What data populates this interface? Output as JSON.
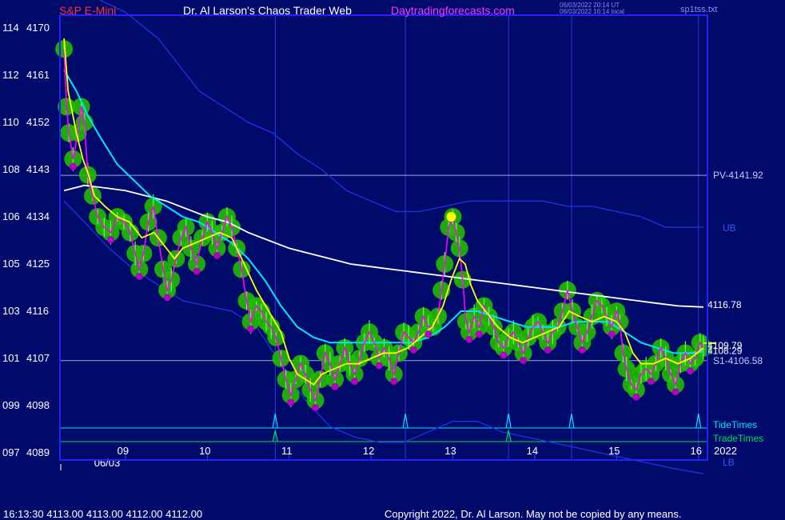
{
  "header": {
    "symbol": "S&P E-Mini",
    "site": "Dr. Al Larson's Chaos Trader Web",
    "url": "Daytradingforecasts.com",
    "time_utc": "06/03/2022 20:14 UT",
    "time_local": "06/03/2022 16:14 local",
    "file": "sp1tss.txt"
  },
  "footer": {
    "ohlc": "16:13:30  4113.00 4113.00 4112.00 4112.00",
    "copyright": "Copyright 2022, Dr. Al Larson. May not be copied by any means."
  },
  "colors": {
    "background": "#000a6b",
    "frame": "#2222ff",
    "price": "#ff00ff",
    "price_halo": "#22bb00",
    "fast_ma": "#ffff00",
    "slow_ma": "#00e5ff",
    "long_ma": "#ffffff",
    "bands": "#1f33e6",
    "tide": "#00e5ff",
    "trade": "#00dd55"
  },
  "chart_data": {
    "type": "line",
    "title": "S&P E-Mini",
    "date_label": "06/03",
    "year_label": "2022",
    "x_tick_labels": [
      "09",
      "10",
      "11",
      "12",
      "13",
      "14",
      "15",
      "16"
    ],
    "x_range": [
      8.25,
      16.1
    ],
    "y_range": [
      4089,
      4170
    ],
    "y_ticks": [
      {
        "left": "097",
        "right": "4089",
        "value": 4089
      },
      {
        "left": "099",
        "right": "4098",
        "value": 4098
      },
      {
        "left": "101",
        "right": "4107",
        "value": 4107
      },
      {
        "left": "103",
        "right": "4116",
        "value": 4116
      },
      {
        "left": "105",
        "right": "4125",
        "value": 4125
      },
      {
        "left": "106",
        "right": "4134",
        "value": 4134
      },
      {
        "left": "108",
        "right": "4143",
        "value": 4143
      },
      {
        "left": "110",
        "right": "4152",
        "value": 4152
      },
      {
        "left": "112",
        "right": "4161",
        "value": 4161
      },
      {
        "left": "114",
        "right": "4170",
        "value": 4170
      }
    ],
    "levels": [
      {
        "label": "PV-4141.92",
        "value": 4141.92
      },
      {
        "label": "S1-4106.58",
        "value": 4106.58
      }
    ],
    "end_labels": {
      "long_ma": "4116.78",
      "slow_ma": "4108.29",
      "fast_ma": "4109.79",
      "upper_band": "UB",
      "lower_band": "LB"
    },
    "tide_times_label": "TideTimes",
    "trade_times_label": "TradeTimes",
    "tide_times": [
      10.83,
      12.42,
      13.68,
      14.45,
      16.0
    ],
    "trade_times": [
      10.83,
      13.68
    ],
    "price": [
      [
        8.25,
        4166
      ],
      [
        8.28,
        4155
      ],
      [
        8.31,
        4150
      ],
      [
        8.36,
        4145
      ],
      [
        8.42,
        4150
      ],
      [
        8.46,
        4155
      ],
      [
        8.5,
        4152
      ],
      [
        8.54,
        4142
      ],
      [
        8.6,
        4138
      ],
      [
        8.66,
        4134
      ],
      [
        8.74,
        4132
      ],
      [
        8.82,
        4131
      ],
      [
        8.9,
        4134
      ],
      [
        8.98,
        4133
      ],
      [
        9.06,
        4131
      ],
      [
        9.12,
        4127
      ],
      [
        9.17,
        4124
      ],
      [
        9.22,
        4127
      ],
      [
        9.28,
        4133
      ],
      [
        9.34,
        4136
      ],
      [
        9.4,
        4130
      ],
      [
        9.46,
        4124
      ],
      [
        9.51,
        4120
      ],
      [
        9.56,
        4122
      ],
      [
        9.62,
        4126
      ],
      [
        9.68,
        4130
      ],
      [
        9.74,
        4132
      ],
      [
        9.8,
        4128
      ],
      [
        9.87,
        4125
      ],
      [
        9.94,
        4130
      ],
      [
        10.0,
        4133
      ],
      [
        10.06,
        4131
      ],
      [
        10.12,
        4128
      ],
      [
        10.18,
        4131
      ],
      [
        10.24,
        4134
      ],
      [
        10.3,
        4132
      ],
      [
        10.36,
        4128
      ],
      [
        10.42,
        4124
      ],
      [
        10.48,
        4118
      ],
      [
        10.53,
        4114
      ],
      [
        10.6,
        4117
      ],
      [
        10.66,
        4116
      ],
      [
        10.72,
        4114
      ],
      [
        10.78,
        4113
      ],
      [
        10.84,
        4111
      ],
      [
        10.9,
        4107
      ],
      [
        10.96,
        4103
      ],
      [
        11.02,
        4100
      ],
      [
        11.08,
        4103
      ],
      [
        11.14,
        4106
      ],
      [
        11.2,
        4104
      ],
      [
        11.26,
        4101
      ],
      [
        11.32,
        4099
      ],
      [
        11.38,
        4103
      ],
      [
        11.44,
        4108
      ],
      [
        11.5,
        4106
      ],
      [
        11.56,
        4103
      ],
      [
        11.62,
        4106
      ],
      [
        11.68,
        4109
      ],
      [
        11.74,
        4106
      ],
      [
        11.8,
        4104
      ],
      [
        11.86,
        4107
      ],
      [
        11.92,
        4110
      ],
      [
        11.98,
        4112
      ],
      [
        12.04,
        4110
      ],
      [
        12.1,
        4107
      ],
      [
        12.16,
        4109
      ],
      [
        12.22,
        4107
      ],
      [
        12.28,
        4104
      ],
      [
        12.34,
        4108
      ],
      [
        12.4,
        4112
      ],
      [
        12.46,
        4111
      ],
      [
        12.52,
        4110
      ],
      [
        12.58,
        4112
      ],
      [
        12.64,
        4115
      ],
      [
        12.7,
        4113
      ],
      [
        12.76,
        4113
      ],
      [
        12.82,
        4115
      ],
      [
        12.86,
        4120
      ],
      [
        12.9,
        4125
      ],
      [
        12.95,
        4132
      ],
      [
        13.0,
        4134
      ],
      [
        13.04,
        4131
      ],
      [
        13.08,
        4128
      ],
      [
        13.12,
        4122
      ],
      [
        13.16,
        4114
      ],
      [
        13.2,
        4112
      ],
      [
        13.26,
        4115
      ],
      [
        13.32,
        4113
      ],
      [
        13.38,
        4117
      ],
      [
        13.44,
        4115
      ],
      [
        13.5,
        4113
      ],
      [
        13.56,
        4110
      ],
      [
        13.62,
        4109
      ],
      [
        13.68,
        4111
      ],
      [
        13.74,
        4112
      ],
      [
        13.8,
        4110
      ],
      [
        13.86,
        4108
      ],
      [
        13.92,
        4111
      ],
      [
        13.98,
        4113
      ],
      [
        14.04,
        4114
      ],
      [
        14.1,
        4112
      ],
      [
        14.16,
        4110
      ],
      [
        14.22,
        4112
      ],
      [
        14.28,
        4113
      ],
      [
        14.34,
        4116
      ],
      [
        14.4,
        4120
      ],
      [
        14.46,
        4116
      ],
      [
        14.52,
        4113
      ],
      [
        14.58,
        4110
      ],
      [
        14.64,
        4112
      ],
      [
        14.7,
        4115
      ],
      [
        14.76,
        4118
      ],
      [
        14.82,
        4117
      ],
      [
        14.88,
        4115
      ],
      [
        14.94,
        4113
      ],
      [
        15.0,
        4116
      ],
      [
        15.04,
        4114
      ],
      [
        15.08,
        4108
      ],
      [
        15.12,
        4105
      ],
      [
        15.18,
        4102
      ],
      [
        15.24,
        4101
      ],
      [
        15.3,
        4104
      ],
      [
        15.36,
        4105
      ],
      [
        15.42,
        4104
      ],
      [
        15.48,
        4106
      ],
      [
        15.54,
        4109
      ],
      [
        15.6,
        4107
      ],
      [
        15.66,
        4104
      ],
      [
        15.72,
        4102
      ],
      [
        15.78,
        4106
      ],
      [
        15.84,
        4108
      ],
      [
        15.9,
        4106
      ],
      [
        15.96,
        4107
      ],
      [
        16.02,
        4110
      ],
      [
        16.06,
        4109
      ]
    ],
    "fast_ma": [
      [
        8.25,
        4168
      ],
      [
        8.3,
        4158
      ],
      [
        8.4,
        4150
      ],
      [
        8.48,
        4145
      ],
      [
        8.55,
        4142
      ],
      [
        8.62,
        4138
      ],
      [
        8.75,
        4136
      ],
      [
        8.9,
        4134
      ],
      [
        9.05,
        4133
      ],
      [
        9.2,
        4130
      ],
      [
        9.35,
        4131
      ],
      [
        9.5,
        4128
      ],
      [
        9.6,
        4126
      ],
      [
        9.7,
        4128
      ],
      [
        9.85,
        4129
      ],
      [
        10.0,
        4130
      ],
      [
        10.15,
        4131
      ],
      [
        10.3,
        4130
      ],
      [
        10.45,
        4125
      ],
      [
        10.6,
        4120
      ],
      [
        10.75,
        4116
      ],
      [
        10.9,
        4112
      ],
      [
        11.0,
        4107
      ],
      [
        11.1,
        4104
      ],
      [
        11.2,
        4103
      ],
      [
        11.3,
        4102
      ],
      [
        11.4,
        4104
      ],
      [
        11.55,
        4105
      ],
      [
        11.7,
        4106
      ],
      [
        11.85,
        4106
      ],
      [
        12.0,
        4107
      ],
      [
        12.15,
        4108
      ],
      [
        12.3,
        4108
      ],
      [
        12.45,
        4109
      ],
      [
        12.6,
        4111
      ],
      [
        12.75,
        4113
      ],
      [
        12.88,
        4117
      ],
      [
        12.98,
        4122
      ],
      [
        13.08,
        4126
      ],
      [
        13.15,
        4125
      ],
      [
        13.22,
        4121
      ],
      [
        13.3,
        4118
      ],
      [
        13.4,
        4116
      ],
      [
        13.55,
        4113
      ],
      [
        13.7,
        4111
      ],
      [
        13.85,
        4110
      ],
      [
        14.0,
        4111
      ],
      [
        14.15,
        4112
      ],
      [
        14.3,
        4113
      ],
      [
        14.42,
        4116
      ],
      [
        14.55,
        4115
      ],
      [
        14.7,
        4114
      ],
      [
        14.85,
        4115
      ],
      [
        15.0,
        4114
      ],
      [
        15.1,
        4112
      ],
      [
        15.2,
        4108
      ],
      [
        15.3,
        4106
      ],
      [
        15.45,
        4106
      ],
      [
        15.6,
        4107
      ],
      [
        15.75,
        4106
      ],
      [
        15.9,
        4107
      ],
      [
        16.06,
        4109
      ]
    ],
    "slow_ma": [
      [
        8.25,
        4162
      ],
      [
        8.4,
        4158
      ],
      [
        8.55,
        4153
      ],
      [
        8.7,
        4149
      ],
      [
        8.9,
        4144
      ],
      [
        9.1,
        4141
      ],
      [
        9.3,
        4138
      ],
      [
        9.5,
        4136
      ],
      [
        9.7,
        4134
      ],
      [
        9.9,
        4133
      ],
      [
        10.1,
        4131
      ],
      [
        10.3,
        4129
      ],
      [
        10.5,
        4126
      ],
      [
        10.7,
        4122
      ],
      [
        10.9,
        4117
      ],
      [
        11.1,
        4113
      ],
      [
        11.3,
        4111
      ],
      [
        11.5,
        4110
      ],
      [
        11.7,
        4110
      ],
      [
        11.9,
        4110
      ],
      [
        12.1,
        4110
      ],
      [
        12.3,
        4110
      ],
      [
        12.5,
        4110
      ],
      [
        12.7,
        4111
      ],
      [
        12.9,
        4113
      ],
      [
        13.1,
        4116
      ],
      [
        13.3,
        4116
      ],
      [
        13.5,
        4115
      ],
      [
        13.7,
        4114
      ],
      [
        13.9,
        4113
      ],
      [
        14.1,
        4113
      ],
      [
        14.3,
        4113
      ],
      [
        14.5,
        4114
      ],
      [
        14.7,
        4114
      ],
      [
        14.9,
        4114
      ],
      [
        15.1,
        4112
      ],
      [
        15.3,
        4110
      ],
      [
        15.5,
        4109
      ],
      [
        15.7,
        4108
      ],
      [
        15.9,
        4108
      ],
      [
        16.06,
        4108.3
      ]
    ],
    "long_ma": [
      [
        8.25,
        4139
      ],
      [
        8.5,
        4140
      ],
      [
        8.75,
        4139.5
      ],
      [
        9.0,
        4139
      ],
      [
        9.25,
        4138
      ],
      [
        9.5,
        4137
      ],
      [
        9.75,
        4135.5
      ],
      [
        10.0,
        4134
      ],
      [
        10.25,
        4133
      ],
      [
        10.5,
        4131
      ],
      [
        10.75,
        4129.5
      ],
      [
        11.0,
        4128
      ],
      [
        11.25,
        4127
      ],
      [
        11.5,
        4126
      ],
      [
        11.75,
        4125
      ],
      [
        12.0,
        4124.5
      ],
      [
        12.25,
        4124
      ],
      [
        12.5,
        4123.5
      ],
      [
        12.75,
        4123
      ],
      [
        13.0,
        4122.5
      ],
      [
        13.25,
        4122
      ],
      [
        13.5,
        4121.5
      ],
      [
        13.75,
        4121
      ],
      [
        14.0,
        4120.5
      ],
      [
        14.25,
        4120
      ],
      [
        14.5,
        4119.5
      ],
      [
        14.75,
        4119
      ],
      [
        15.0,
        4118.5
      ],
      [
        15.25,
        4118
      ],
      [
        15.5,
        4117.5
      ],
      [
        15.75,
        4117
      ],
      [
        16.06,
        4116.8
      ]
    ],
    "upper_band": [
      [
        8.25,
        4178
      ],
      [
        8.6,
        4176
      ],
      [
        9.0,
        4173
      ],
      [
        9.4,
        4168
      ],
      [
        9.7,
        4162
      ],
      [
        9.9,
        4158
      ],
      [
        10.2,
        4155
      ],
      [
        10.5,
        4152
      ],
      [
        10.8,
        4150
      ],
      [
        11.1,
        4146
      ],
      [
        11.4,
        4143
      ],
      [
        11.7,
        4139
      ],
      [
        12.0,
        4137
      ],
      [
        12.3,
        4135
      ],
      [
        12.6,
        4135
      ],
      [
        12.9,
        4136
      ],
      [
        13.2,
        4137
      ],
      [
        13.5,
        4137
      ],
      [
        13.8,
        4137
      ],
      [
        14.1,
        4137
      ],
      [
        14.4,
        4136
      ],
      [
        14.7,
        4136
      ],
      [
        15.0,
        4135
      ],
      [
        15.3,
        4134
      ],
      [
        15.6,
        4132
      ],
      [
        16.06,
        4132
      ]
    ],
    "lower_band": [
      [
        8.25,
        4137
      ],
      [
        8.5,
        4133
      ],
      [
        8.8,
        4128
      ],
      [
        9.1,
        4124
      ],
      [
        9.4,
        4121
      ],
      [
        9.7,
        4118
      ],
      [
        10.0,
        4117
      ],
      [
        10.3,
        4116
      ],
      [
        10.6,
        4113
      ],
      [
        10.9,
        4106
      ],
      [
        11.2,
        4099
      ],
      [
        11.5,
        4094
      ],
      [
        11.8,
        4092
      ],
      [
        12.1,
        4091
      ],
      [
        12.4,
        4091
      ],
      [
        12.7,
        4093
      ],
      [
        13.0,
        4095
      ],
      [
        13.3,
        4095
      ],
      [
        13.6,
        4093
      ],
      [
        13.9,
        4092
      ],
      [
        14.2,
        4091
      ],
      [
        14.5,
        4090
      ],
      [
        14.8,
        4089
      ],
      [
        15.1,
        4088
      ],
      [
        15.4,
        4087
      ],
      [
        15.7,
        4086
      ],
      [
        16.06,
        4085
      ]
    ],
    "highlight_point": [
      12.98,
      4134
    ]
  }
}
